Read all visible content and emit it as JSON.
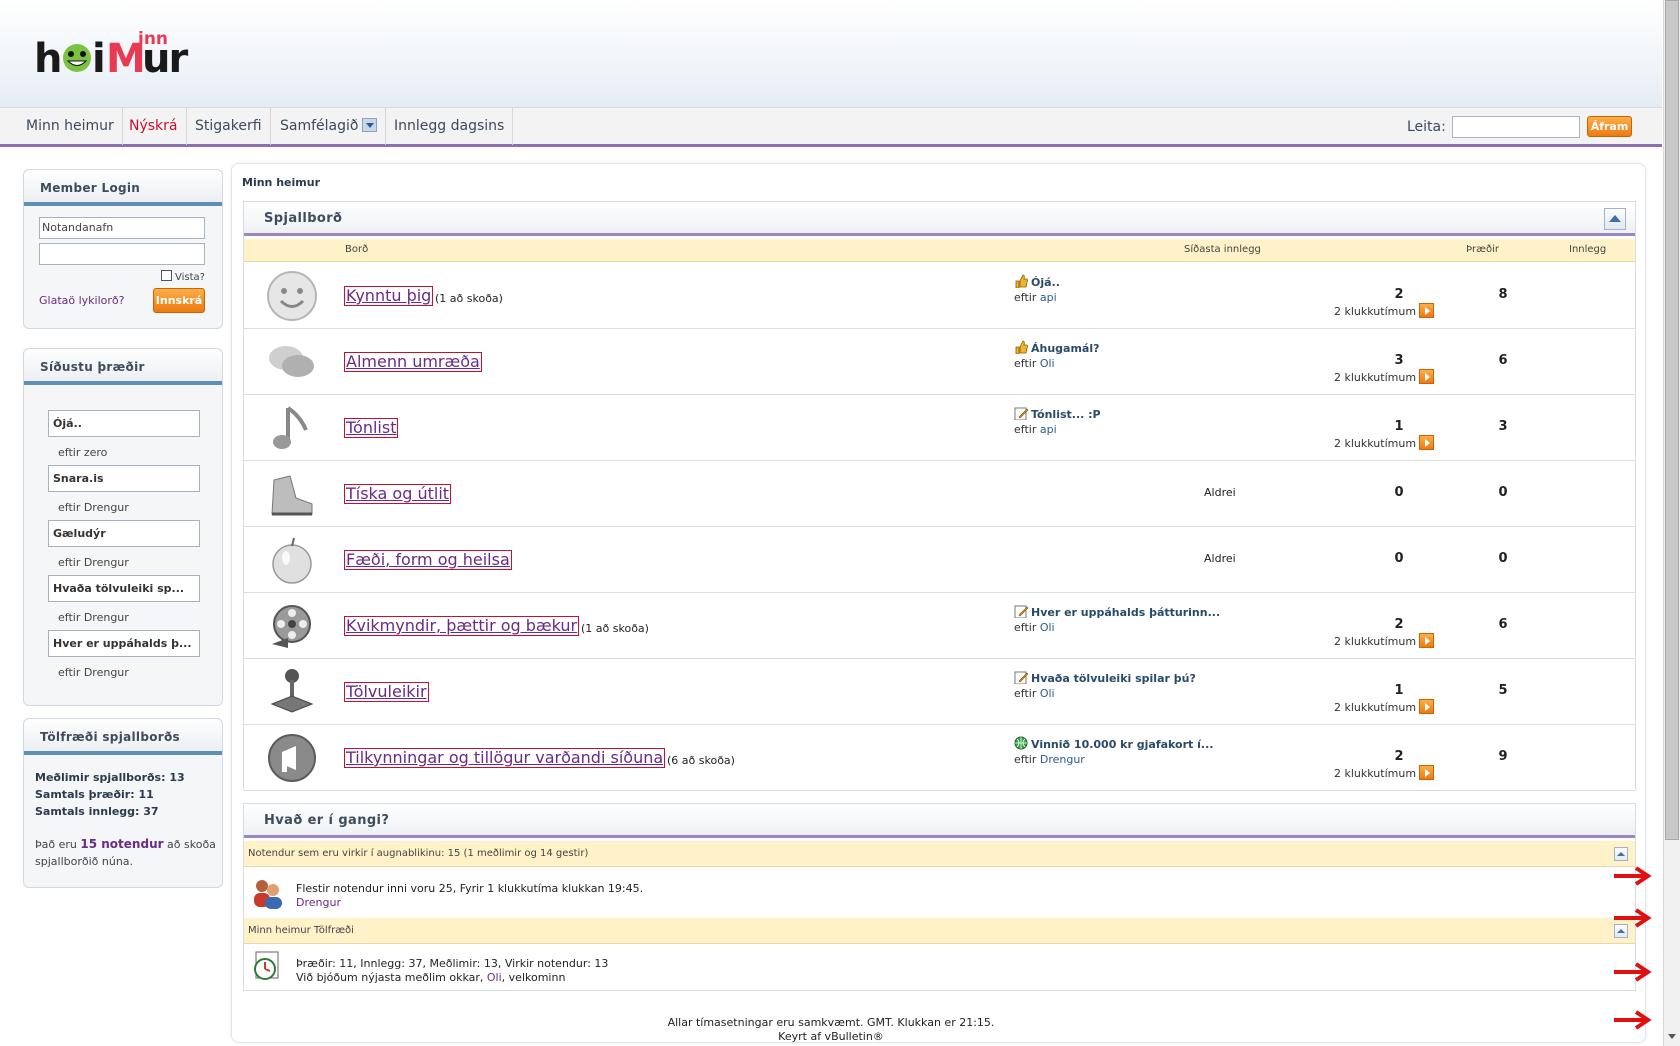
{
  "header": {
    "logo_text": "heimur",
    "logo_sup": "Minn"
  },
  "nav": {
    "items": [
      "Minn heimur",
      "Nýskrá",
      "Stigakerfi",
      "Samfélagið",
      "Innlegg dagsins"
    ],
    "search_label": "Leita:",
    "search_button": "Áfram"
  },
  "login": {
    "title": "Member Login",
    "username_placeholder": "Notandanafn",
    "remember_label": "Vista?",
    "forgot_link": "Glataö lykilorð?",
    "login_button": "Innskrá"
  },
  "recent": {
    "title": "Síðustu þræðir",
    "threads": [
      {
        "title": "Ójá..",
        "by": "eftir zero"
      },
      {
        "title": "Snara.is",
        "by": "eftir Drengur"
      },
      {
        "title": "Gæludýr",
        "by": "eftir Drengur"
      },
      {
        "title": "Hvaða tölvuleiki sp...",
        "by": "eftir Drengur"
      },
      {
        "title": "Hver er uppáhalds þ...",
        "by": "eftir Drengur"
      }
    ]
  },
  "stats_box": {
    "title": "Tölfræði spjallborðs",
    "members": "Meðlimir spjallborðs: 13",
    "threads": "Samtals þræðir: 11",
    "posts": "Samtals innlegg: 37",
    "online_pre": "Það eru",
    "online_count": "15 notendur",
    "online_post": "að skoða",
    "online_line2": "spjallborðið núna."
  },
  "main": {
    "breadcrumb": "Minn heimur",
    "section_title": "Spjallborð",
    "columns": {
      "forum": "Borð",
      "last": "Síðasta innlegg",
      "threads": "Þræðir",
      "posts": "Innlegg"
    },
    "forums": [
      {
        "name": "Kynntu þig",
        "views": "(1 að skoða)",
        "icon": "smiley-icon",
        "last_title": "Ójá..",
        "post_icon": "thumbs-up-icon",
        "by_pre": "eftir",
        "by": "api",
        "time": "2 klukkutímum",
        "threads": "2",
        "posts": "8"
      },
      {
        "name": "Almenn umræða",
        "views": "",
        "icon": "speech-bubbles-icon",
        "last_title": "Áhugamál?",
        "post_icon": "thumbs-up-icon",
        "by_pre": "eftir",
        "by": "Oli",
        "time": "2 klukkutímum",
        "threads": "3",
        "posts": "6"
      },
      {
        "name": "Tónlist",
        "views": "",
        "icon": "music-note-icon",
        "last_title": "Tónlist... :P",
        "post_icon": "note-pencil-icon",
        "by_pre": "eftir",
        "by": "api",
        "time": "2 klukkutímum",
        "threads": "1",
        "posts": "3"
      },
      {
        "name": "Tíska og útlit",
        "views": "",
        "icon": "sneaker-icon",
        "last_title": "",
        "post_icon": "",
        "by_pre": "",
        "by": "",
        "time": "",
        "never": "Aldrei",
        "threads": "0",
        "posts": "0"
      },
      {
        "name": "Fæði, form og heilsa",
        "views": "",
        "icon": "apple-icon",
        "last_title": "",
        "post_icon": "",
        "by_pre": "",
        "by": "",
        "time": "",
        "never": "Aldrei",
        "threads": "0",
        "posts": "0"
      },
      {
        "name": "Kvikmyndir, þættir og bækur",
        "views": "(1 að skoða)",
        "icon": "film-reel-icon",
        "last_title": "Hver er uppáhalds þátturinn...",
        "post_icon": "note-pencil-icon",
        "by_pre": "eftir",
        "by": "Oli",
        "time": "2 klukkutímum",
        "threads": "2",
        "posts": "6"
      },
      {
        "name": "Tölvuleikir",
        "views": "",
        "icon": "joystick-icon",
        "last_title": "Hvaða tölvuleiki spilar þú?",
        "post_icon": "note-pencil-icon",
        "by_pre": "eftir",
        "by": "Oli",
        "time": "2 klukkutímum",
        "threads": "1",
        "posts": "5"
      },
      {
        "name": "Tilkynningar og tillögur varðandi síðuna",
        "views": "(6 að skoða)",
        "icon": "megaphone-icon",
        "last_title": "Vinnið 10.000 kr gjafakort í...",
        "post_icon": "globe-icon",
        "by_pre": "eftir",
        "by": "Drengur",
        "time": "2 klukkutímum",
        "threads": "2",
        "posts": "9"
      }
    ]
  },
  "whats_going_on": {
    "title": "Hvað er í gangi?",
    "online_bar": "Notendur sem eru virkir í augnablikinu: 15 (1 meðlimir og 14 gestir)",
    "online_line": "Flestir notendur inni voru 25, Fyrir 1 klukkutíma klukkan 19:45.",
    "online_user": "Drengur",
    "stats_bar": "Minn heimur Tölfræði",
    "stats_line": "Þræðir: 11, Innlegg: 37, Meðlimir: 13, Virkir notendur: 13",
    "welcome_pre": "Við bjóðum nýjasta meðlim okkar,",
    "welcome_user": "Oli",
    "welcome_post": ", velkominn"
  },
  "footer": {
    "line1": "Allar tímasetningar eru samkvæmt. GMT. Klukkan er 21:15.",
    "line2": "Keyrt af vBulletin®"
  },
  "colors": {
    "accent": "#8c6fb3",
    "orange": "#ef7a10",
    "link": "#6a2a86",
    "highlight_border": "#c8102e"
  }
}
